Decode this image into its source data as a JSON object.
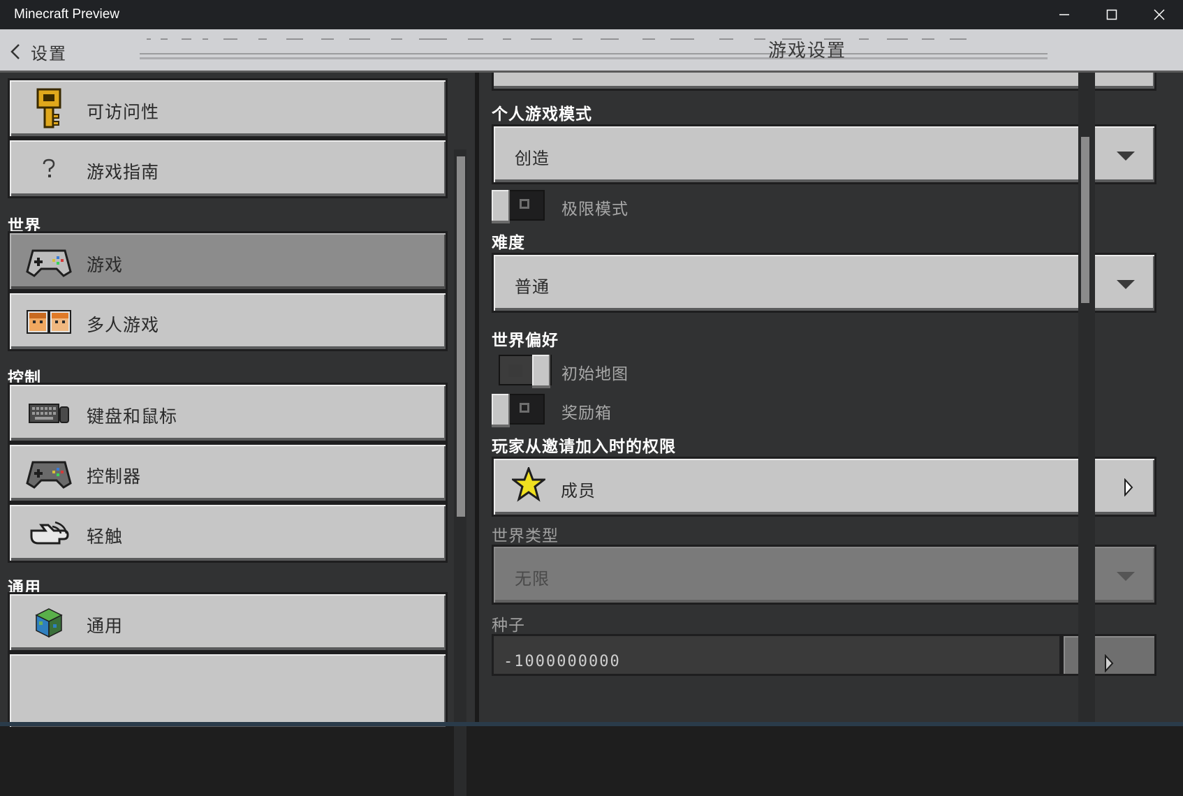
{
  "window": {
    "title": "Minecraft Preview"
  },
  "header": {
    "back_label": "设置",
    "title": "游戏设置"
  },
  "sidebar": {
    "items_top": [
      {
        "label": "可访问性",
        "icon": "key-icon"
      },
      {
        "label": "游戏指南",
        "icon": "question-icon"
      }
    ],
    "sections": [
      {
        "title": "世界",
        "items": [
          {
            "label": "游戏",
            "icon": "controller-icon",
            "selected": true
          },
          {
            "label": "多人游戏",
            "icon": "players-icon",
            "selected": false
          }
        ]
      },
      {
        "title": "控制",
        "items": [
          {
            "label": "键盘和鼠标",
            "icon": "keyboard-mouse-icon"
          },
          {
            "label": "控制器",
            "icon": "controller-icon"
          },
          {
            "label": "轻触",
            "icon": "touch-icon"
          }
        ]
      },
      {
        "title": "通用",
        "items": [
          {
            "label": "通用",
            "icon": "grass-cube-icon"
          }
        ]
      }
    ]
  },
  "settings": {
    "personal_game_mode": {
      "label": "个人游戏模式",
      "value": "创造"
    },
    "hardcore": {
      "label": "极限模式",
      "on": false
    },
    "difficulty": {
      "label": "难度",
      "value": "普通"
    },
    "world_preferences": {
      "label": "世界偏好",
      "starting_map": {
        "label": "初始地图",
        "on": true
      },
      "bonus_chest": {
        "label": "奖励箱",
        "on": false
      }
    },
    "invite_permission": {
      "label": "玩家从邀请加入时的权限",
      "value": "成员",
      "icon": "star-icon"
    },
    "world_type": {
      "label": "世界类型",
      "value": "无限",
      "disabled": true
    },
    "seed": {
      "label": "种子",
      "value": "-1000000000"
    }
  },
  "colors": {
    "panel": "#313233",
    "button": "#c6c6c6",
    "selected": "#8c8c8c",
    "titlebar": "#202225"
  }
}
